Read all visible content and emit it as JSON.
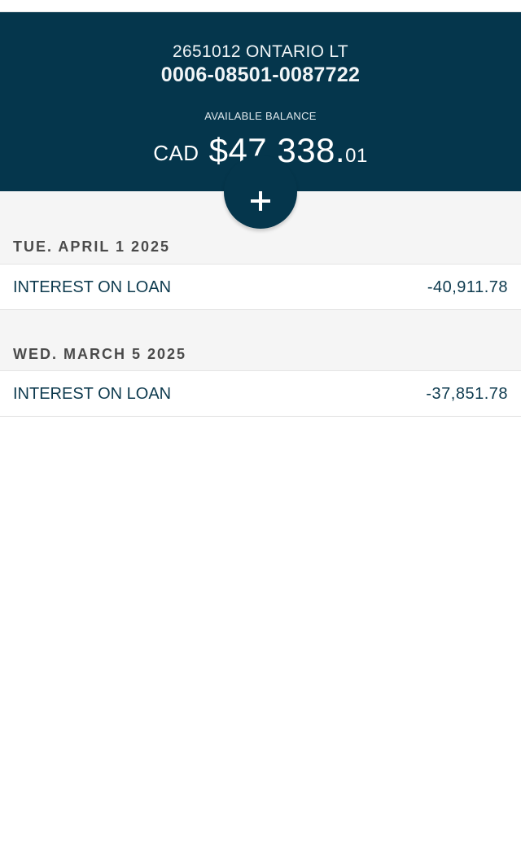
{
  "account": {
    "name": "2651012 ONTARIO LT",
    "number": "0006-08501-0087722",
    "balance_label": "AVAILABLE BALANCE",
    "currency": "CAD",
    "balance_main": "$47,338.",
    "balance_cents": "01"
  },
  "add_button": {
    "icon": "plus-icon"
  },
  "transactions": [
    {
      "date": "TUE. APRIL 1 2025",
      "description": "INTEREST ON LOAN",
      "amount": "-40,911.78"
    },
    {
      "date": "WED. MARCH 5 2025",
      "description": "INTEREST ON LOAN",
      "amount": "-37,851.78"
    }
  ],
  "colors": {
    "header_bg": "#05364c",
    "section_bg": "#f5f5f5",
    "text_dark": "#0d3a4e"
  }
}
